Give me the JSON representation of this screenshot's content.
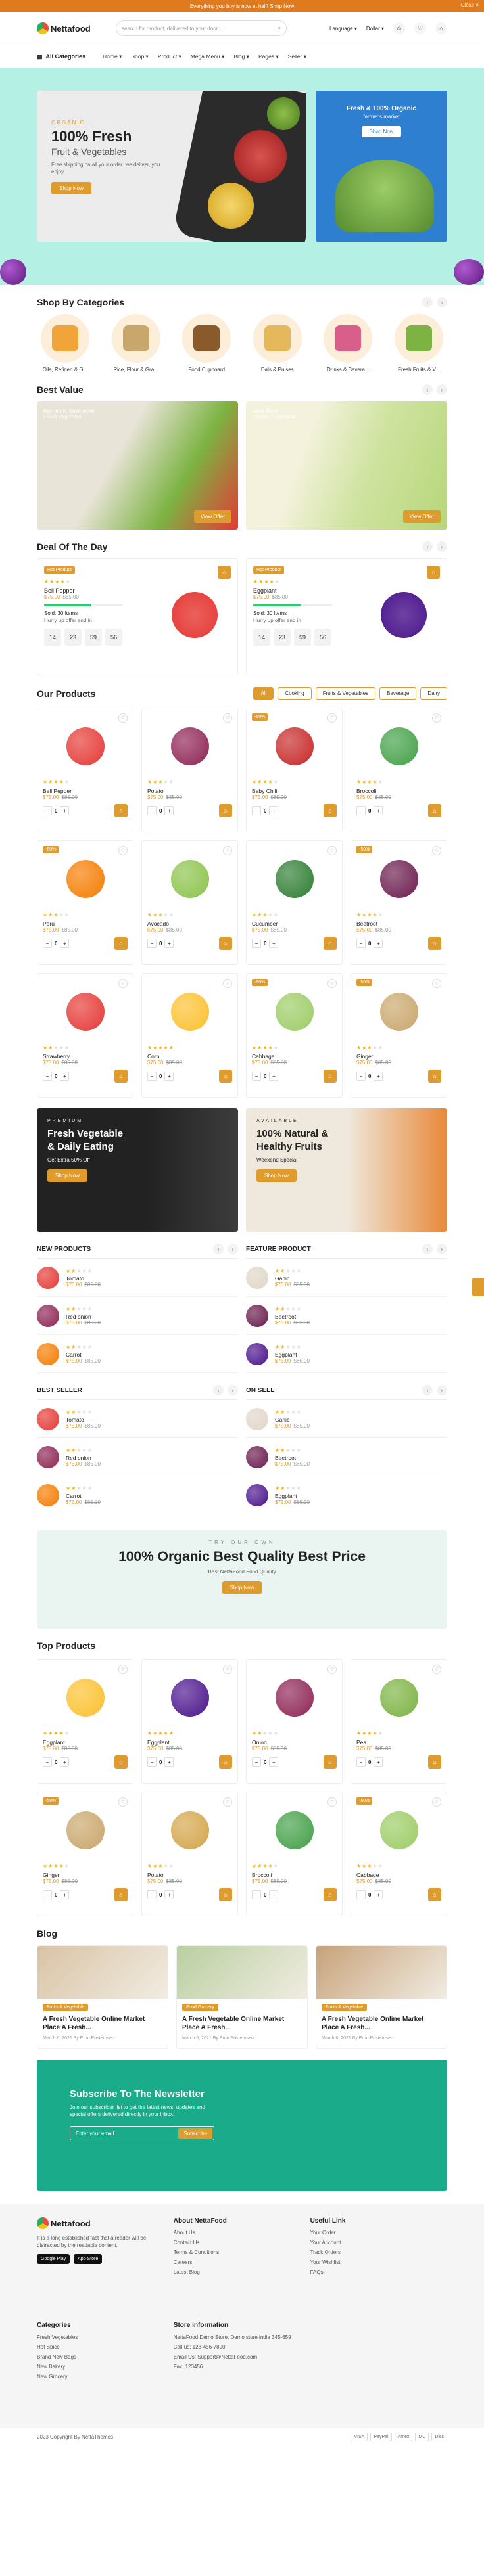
{
  "topbar": {
    "text": "Everything you buy is now at half!",
    "shop_link": "Shop Now",
    "close": "Close ×"
  },
  "header": {
    "logo": "Nettafood",
    "search_placeholder": "search for product, delivered to your door...",
    "language": "Language",
    "currency": "Dollar",
    "wishlist_count": "0",
    "cart_count": "0"
  },
  "nav": {
    "all_categories": "All Categories",
    "items": [
      "Home",
      "Shop",
      "Product",
      "Mega Menu",
      "Blog",
      "Pages",
      "Seller"
    ]
  },
  "hero": {
    "kicker": "ORGANIC",
    "title": "100% Fresh",
    "subtitle": "Fruit & Vegetables",
    "desc": "Free shipping on all your order. we deliver, you enjoy",
    "button": "Shop Now",
    "side_title": "Fresh & 100% Organic",
    "side_sub": "farmer's market",
    "side_button": "Shop Now"
  },
  "categories": {
    "title": "Shop By Categories",
    "items": [
      {
        "label": "Oils, Refined & G...",
        "color": "#f0a43a"
      },
      {
        "label": "Rice, Flour & Gra...",
        "color": "#c9a66b"
      },
      {
        "label": "Food Cupboard",
        "color": "#8b5a2b"
      },
      {
        "label": "Dals & Pulses",
        "color": "#e6b85c"
      },
      {
        "label": "Drinks & Bevera...",
        "color": "#d95f8a"
      },
      {
        "label": "Fresh Fruits & V...",
        "color": "#7cb342"
      }
    ]
  },
  "best_value": {
    "title": "Best Value",
    "cards": [
      {
        "tag": "Buy more, Save more",
        "sub": "Fresh Vegetable",
        "button": "View Offer",
        "bg": "#e9e4d8"
      },
      {
        "tag": "Save More",
        "sub": "Organic Vegetable",
        "button": "View Offer",
        "bg": "#d8e7b8"
      }
    ]
  },
  "deal": {
    "title": "Deal Of The Day",
    "cards": [
      {
        "badge": "Hot Product",
        "name": "Bell Pepper",
        "price": "$75.00",
        "old": "$85.00",
        "sold": "Sold: 30 Items",
        "hurry": "Hurry up offer end in",
        "progress": 0.6,
        "timer": [
          "14",
          "23",
          "59",
          "56"
        ],
        "color": "#e53935"
      },
      {
        "badge": "Hot Product",
        "name": "Eggplant",
        "price": "$75.00",
        "old": "$85.00",
        "sold": "Sold: 30 Items",
        "hurry": "Hurry up offer end in",
        "progress": 0.6,
        "timer": [
          "14",
          "23",
          "59",
          "56"
        ],
        "color": "#4a148c"
      }
    ]
  },
  "products": {
    "title": "Our Products",
    "tabs": [
      "All",
      "Cooking",
      "Fruits & Vegetables",
      "Beverage",
      "Dairy"
    ],
    "items": [
      {
        "name": "Bell Pepper",
        "price": "$75.00",
        "old": "$85.00",
        "stars": 4,
        "disc": "",
        "color": "#e53935"
      },
      {
        "name": "Potato",
        "price": "$75.00",
        "old": "$85.00",
        "stars": 3,
        "disc": "",
        "color": "#8e2454"
      },
      {
        "name": "Baby Chili",
        "price": "$75.00",
        "old": "$85.00",
        "stars": 4,
        "disc": "-50%",
        "color": "#c62828"
      },
      {
        "name": "Broccoli",
        "price": "$75.00",
        "old": "$85.00",
        "stars": 4,
        "disc": "",
        "color": "#43a047"
      },
      {
        "name": "Peru",
        "price": "$75.00",
        "old": "$85.00",
        "stars": 3,
        "disc": "-50%",
        "color": "#f57c00"
      },
      {
        "name": "Avocado",
        "price": "$75.00",
        "old": "$85.00",
        "stars": 3,
        "disc": "",
        "color": "#8bc34a"
      },
      {
        "name": "Cucumber",
        "price": "$75.00",
        "old": "$85.00",
        "stars": 3,
        "disc": "",
        "color": "#2e7d32"
      },
      {
        "name": "Beetroot",
        "price": "$75.00",
        "old": "$85.00",
        "stars": 4,
        "disc": "-50%",
        "color": "#6a1b4d"
      },
      {
        "name": "Strawberry",
        "price": "$75.00",
        "old": "$85.00",
        "stars": 2,
        "disc": "",
        "color": "#e53935"
      },
      {
        "name": "Corn",
        "price": "$75.00",
        "old": "$85.00",
        "stars": 5,
        "disc": "",
        "color": "#fbc02d"
      },
      {
        "name": "Cabbage",
        "price": "$75.00",
        "old": "$85.00",
        "stars": 4,
        "disc": "-50%",
        "color": "#9ccc65"
      },
      {
        "name": "Ginger",
        "price": "$75.00",
        "old": "$85.00",
        "stars": 3,
        "disc": "-50%",
        "color": "#c9a66b"
      }
    ]
  },
  "promo": [
    {
      "kicker": "PREMIUM",
      "title": "Fresh Vegetable & Daily Eating",
      "sub": "Get Extra 50% Off",
      "button": "Shop Now"
    },
    {
      "kicker": "AVAILABLE",
      "title": "100% Natural & Healthy Fruits",
      "sub": "Weekend Special",
      "button": "Shop Now"
    }
  ],
  "lists": [
    {
      "title": "NEW PRODUCTS",
      "items": [
        {
          "name": "Tomato",
          "color": "#e53935"
        },
        {
          "name": "Red onion",
          "color": "#8e2454"
        },
        {
          "name": "Carrot",
          "color": "#f57c00"
        }
      ]
    },
    {
      "title": "FEATURE PRODUCT",
      "items": [
        {
          "name": "Garlic",
          "color": "#e0d6c8"
        },
        {
          "name": "Beetroot",
          "color": "#6a1b4d"
        },
        {
          "name": "Eggplant",
          "color": "#4a148c"
        }
      ]
    },
    {
      "title": "BEST SELLER",
      "items": [
        {
          "name": "Tomato",
          "color": "#e53935"
        },
        {
          "name": "Red onion",
          "color": "#8e2454"
        },
        {
          "name": "Carrot",
          "color": "#f57c00"
        }
      ]
    },
    {
      "title": "ON SELL",
      "items": [
        {
          "name": "Garlic",
          "color": "#e0d6c8"
        },
        {
          "name": "Beetroot",
          "color": "#6a1b4d"
        },
        {
          "name": "Eggplant",
          "color": "#4a148c"
        }
      ]
    }
  ],
  "list_price": "$75.00",
  "list_old": "$85.00",
  "banner": {
    "kicker": "TRY OUR OWN",
    "title": "100% Organic Best Quality Best Price",
    "sub": "Best NettaFood Food Quality",
    "button": "Shop Now"
  },
  "top_products": {
    "title": "Top Products",
    "items": [
      {
        "name": "Eggplant",
        "price": "$75.00",
        "old": "$85.00",
        "stars": 4,
        "disc": "",
        "color": "#fbc02d"
      },
      {
        "name": "Eggplant",
        "price": "$75.00",
        "old": "$85.00",
        "stars": 5,
        "disc": "",
        "color": "#4a148c"
      },
      {
        "name": "Onion",
        "price": "$75.00",
        "old": "$85.00",
        "stars": 2,
        "disc": "",
        "color": "#8e2454"
      },
      {
        "name": "Pea",
        "price": "$75.00",
        "old": "$85.00",
        "stars": 4,
        "disc": "",
        "color": "#7cb342"
      },
      {
        "name": "Ginger",
        "price": "$75.00",
        "old": "$85.00",
        "stars": 4,
        "disc": "-50%",
        "color": "#c9a66b"
      },
      {
        "name": "Potato",
        "price": "$75.00",
        "old": "$85.00",
        "stars": 3,
        "disc": "",
        "color": "#d4a54a"
      },
      {
        "name": "Broccoli",
        "price": "$75.00",
        "old": "$85.00",
        "stars": 4,
        "disc": "",
        "color": "#43a047"
      },
      {
        "name": "Cabbage",
        "price": "$75.00",
        "old": "$85.00",
        "stars": 3,
        "disc": "-50%",
        "color": "#9ccc65"
      }
    ]
  },
  "blog": {
    "title": "Blog",
    "posts": [
      {
        "cat": "Fruits & Vegetable",
        "title": "A Fresh Vegetable Online Market Place A Fresh...",
        "meta": "March 6, 2021   By Errin Posternsen"
      },
      {
        "cat": "Food Grocery",
        "title": "A Fresh Vegetable Online Market Place A Fresh...",
        "meta": "March 6, 2021   By Errin Posternsen"
      },
      {
        "cat": "Fruits & Vegetable",
        "title": "A Fresh Vegetable Online Market Place A Fresh...",
        "meta": "March 6, 2021   By Errin Posternsen"
      }
    ]
  },
  "newsletter": {
    "title": "Subscribe To The Newsletter",
    "desc": "Join our subscriber list to get the latest news, updates and special offers delivered directly in your inbox.",
    "placeholder": "Enter your email",
    "button": "Subscribe"
  },
  "footer": {
    "about": "It is a long established fact that a reader will be distracted by the readable content.",
    "google": "Google Play",
    "apple": "App Store",
    "col2_title": "About NettaFood",
    "col2": [
      "About Us",
      "Contact Us",
      "Terms & Conditions",
      "Careers",
      "Latest Blog"
    ],
    "col3_title": "Useful Link",
    "col3": [
      "Your Order",
      "Your Account",
      "Track Orders",
      "Your Wishlist",
      "FAQs"
    ],
    "col4_title": "Categories",
    "col4": [
      "Fresh Vegetables",
      "Hot Spice",
      "Brand New Bags",
      "New Bakery",
      "New Grocery"
    ],
    "col5_title": "Store information",
    "col5": [
      "NettaFood Demo Store, Demo store india 345-659",
      "Call us: 123-456-7890",
      "Email Us: Support@NettaFood.com",
      "Fax: 123456"
    ],
    "copyright": "2023 Copyright By NettaThemes",
    "payments": [
      "VISA",
      "PayPal",
      "Amex",
      "MC",
      "Disc"
    ]
  }
}
